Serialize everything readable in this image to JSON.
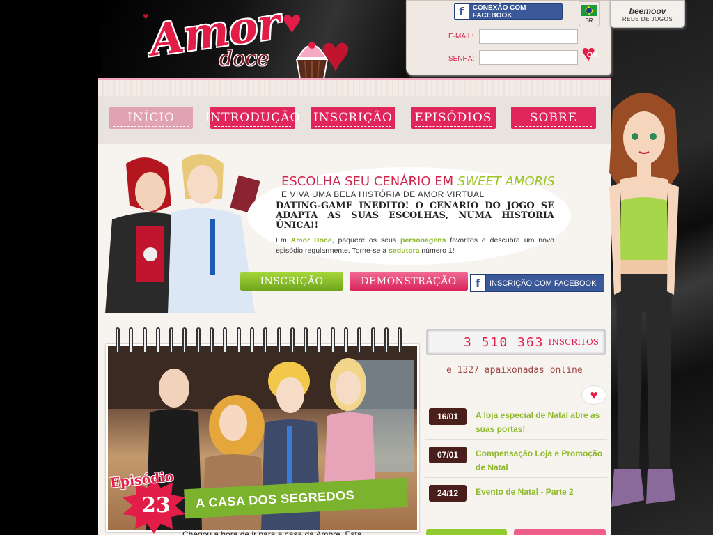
{
  "header": {
    "logo_main": "Amor",
    "logo_sub": "doce",
    "facebook_connect": "CONEXÃO COM FACEBOOK",
    "email_label": "E-MAIL:",
    "password_label": "SENHA:",
    "ok_label": "OK",
    "country_code": "BR",
    "network_brand": "beemoov",
    "network_label": "REDE DE JOGOS"
  },
  "nav": {
    "items": [
      {
        "label": "INÍCIO"
      },
      {
        "label": "INTRODUÇÃO"
      },
      {
        "label": "INSCRIÇÃO"
      },
      {
        "label": "EPISÓDIOS"
      },
      {
        "label": "SOBRE"
      }
    ]
  },
  "hero": {
    "title_prefix": "ESCOLHA SEU CENÁRIO EM",
    "title_highlight": "SWEET AMORIS",
    "subtitle": "E VIVA UMA BELA HISTÓRIA DE AMOR VIRTUAL",
    "headline": "DATING-GAME INEDITO! O CENARIO DO JOGO SE ADAPTA AS SUAS ESCOLHAS, NUMA HISTÓRIA ÚNICA!!",
    "body_1": "Em",
    "body_brand": "Amor Doce",
    "body_2": ", paquere os seus",
    "body_chars": "personagens",
    "body_3": "favoritos e descubra um novo episódio regularmente. Torne-se a",
    "body_seductress": "sedutora",
    "body_4": "número 1!",
    "cta_signup": "INSCRIÇÃO",
    "cta_demo": "DEMONSTRAÇÃO",
    "cta_facebook": "INSCRIÇÃO COM FACEBOOK"
  },
  "episode": {
    "label": "Episódio",
    "number": "23",
    "title": "A CASA DOS SEGREDOS",
    "snippet": "Chegou a hora de ir para a casa da Ambre. Esta"
  },
  "stats": {
    "subscribers": "3 510 363",
    "subscribers_label": "INSCRITOS",
    "online": "e 1327 apaixonadas online"
  },
  "news": [
    {
      "date": "16/01",
      "text": "A loja especial de Natal abre as suas portas!"
    },
    {
      "date": "07/01",
      "text": "Compensação Loja e Promoção de Natal"
    },
    {
      "date": "24/12",
      "text": "Evento de Natal - Parte 2"
    }
  ],
  "colors": {
    "brand_red": "#e11d48",
    "brand_green": "#8fb92c",
    "nav_pink": "#e0265a",
    "facebook_blue": "#3b5998"
  }
}
